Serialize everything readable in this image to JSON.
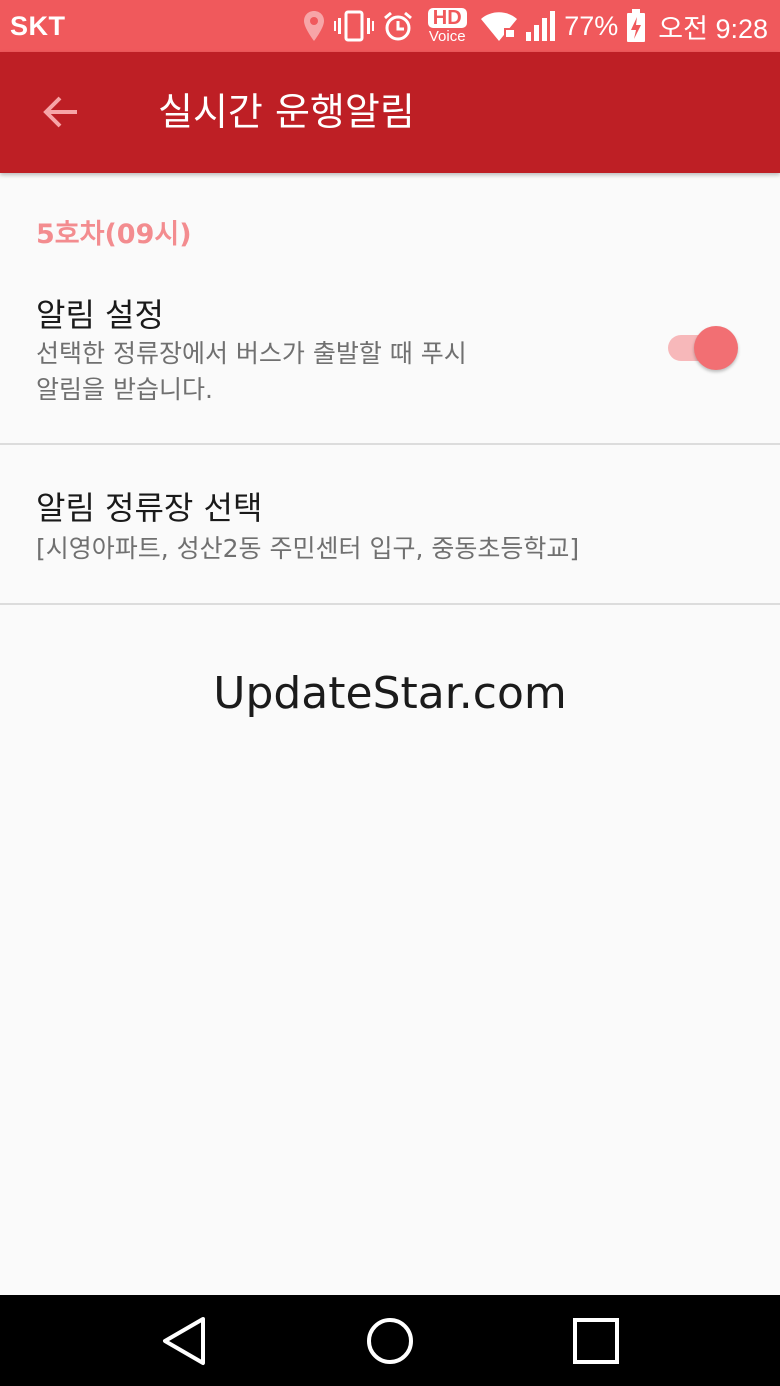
{
  "status_bar": {
    "carrier": "SKT",
    "hd_label": "HD",
    "voice_label": "Voice",
    "battery_percent": "77%",
    "time": "오전 9:28",
    "icons": [
      "location-icon",
      "vibrate-icon",
      "alarm-icon",
      "hd-voice-icon",
      "wifi-icon",
      "signal-icon",
      "battery-charging-icon"
    ]
  },
  "toolbar": {
    "title": "실시간 운행알림",
    "back_icon": "arrow-back-icon"
  },
  "section": {
    "header": "5호차(09시)"
  },
  "preferences": [
    {
      "title": "알림 설정",
      "summary_line1": "선택한 정류장에서 버스가 출발할 때 푸시",
      "summary_line2": "알림을 받습니다.",
      "switch_on": true
    },
    {
      "title": "알림 정류장 선택",
      "summary": "[시영아파트, 성산2동 주민센터 입구, 중동초등학교]"
    }
  ],
  "watermark": "UpdateStar.com",
  "colors": {
    "status_bar": "#f0595c",
    "toolbar": "#be1f25",
    "accent": "#f26f73",
    "section_header": "#f38c8f"
  },
  "nav_bar": {
    "icons": [
      "back-triangle-icon",
      "home-circle-icon",
      "recents-square-icon"
    ]
  }
}
